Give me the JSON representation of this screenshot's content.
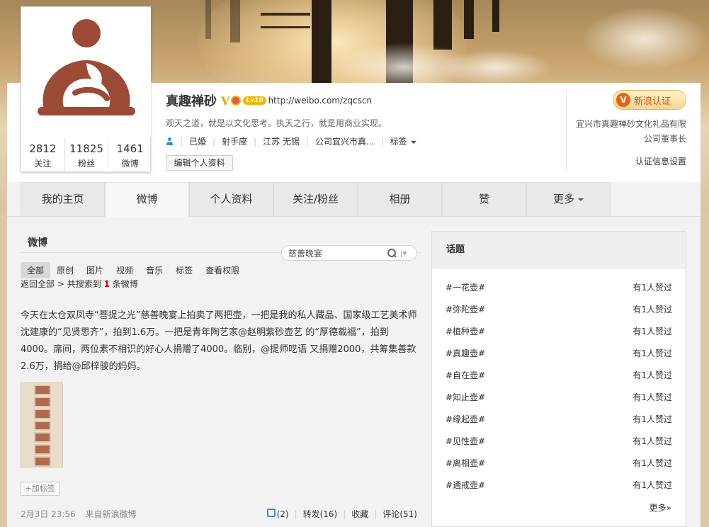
{
  "profile": {
    "name": "真趣禅砂",
    "verified_mark": "V",
    "level_badge": "Lv10",
    "url": "http://weibo.com/zqcscn",
    "motto": "观天之道，就是以文化思考。执天之行，就是用商业实现。",
    "tags": [
      "已婚",
      "射手座",
      "江苏 无锡",
      "公司宜兴市真...",
      "标签"
    ],
    "edit_label": "编辑个人资料",
    "counts": [
      {
        "num": "2812",
        "label": "关注"
      },
      {
        "num": "11825",
        "label": "粉丝"
      },
      {
        "num": "1461",
        "label": "微博"
      }
    ]
  },
  "verify": {
    "badge_text": "新浪认证",
    "badge_letter": "V",
    "desc": "宜兴市真趣禅砂文化礼品有限公司董事长",
    "settings_link": "认证信息设置"
  },
  "tabs": [
    "我的主页",
    "微博",
    "个人资料",
    "关注/粉丝",
    "相册",
    "赞",
    "更多"
  ],
  "feed": {
    "title": "微博",
    "search_value": "慈善晚宴",
    "filters": [
      "全部",
      "原创",
      "图片",
      "视频",
      "音乐",
      "标签",
      "查看权限"
    ],
    "back_label": "返回全部",
    "result_prefix": "共搜索到",
    "result_count": "1",
    "result_suffix": "条微博",
    "post_text": "今天在太仓双凤寺“菩提之光”慈善晚宴上拍卖了两把壶，一把是我的私人藏品、国家级工艺美术师沈建康的“见贤思齐”，拍到1.6万。一把是青年陶艺家@赵明紫砂壶艺 的“厚德载福”，拍到4000。席间，两位素不相识的好心人捐赠了4000。临别，@提师呓语 又捐赠2000，共筹集善款2.6万，捐给@邱梓骏的妈妈。",
    "add_tag": "+加标签",
    "time": "2月3日 23:56",
    "source": "来自新浪微博",
    "likes": "(2)",
    "repost": "转发(16)",
    "favorite": "收藏",
    "comment": "评论(51)"
  },
  "topics": {
    "title": "话题",
    "items": [
      {
        "name": "#一花壶#",
        "status": "有1人赞过"
      },
      {
        "name": "#弥陀壶#",
        "status": "有1人赞过"
      },
      {
        "name": "#植种壶#",
        "status": "有1人赞过"
      },
      {
        "name": "#真趣壶#",
        "status": "有1人赞过"
      },
      {
        "name": "#自在壶#",
        "status": "有1人赞过"
      },
      {
        "name": "#知止壶#",
        "status": "有1人赞过"
      },
      {
        "name": "#缘起壶#",
        "status": "有1人赞过"
      },
      {
        "name": "#见性壶#",
        "status": "有1人赞过"
      },
      {
        "name": "#离相壶#",
        "status": "有1人赞过"
      },
      {
        "name": "#通戒壶#",
        "status": "有1人赞过"
      }
    ],
    "more": "更多»"
  }
}
